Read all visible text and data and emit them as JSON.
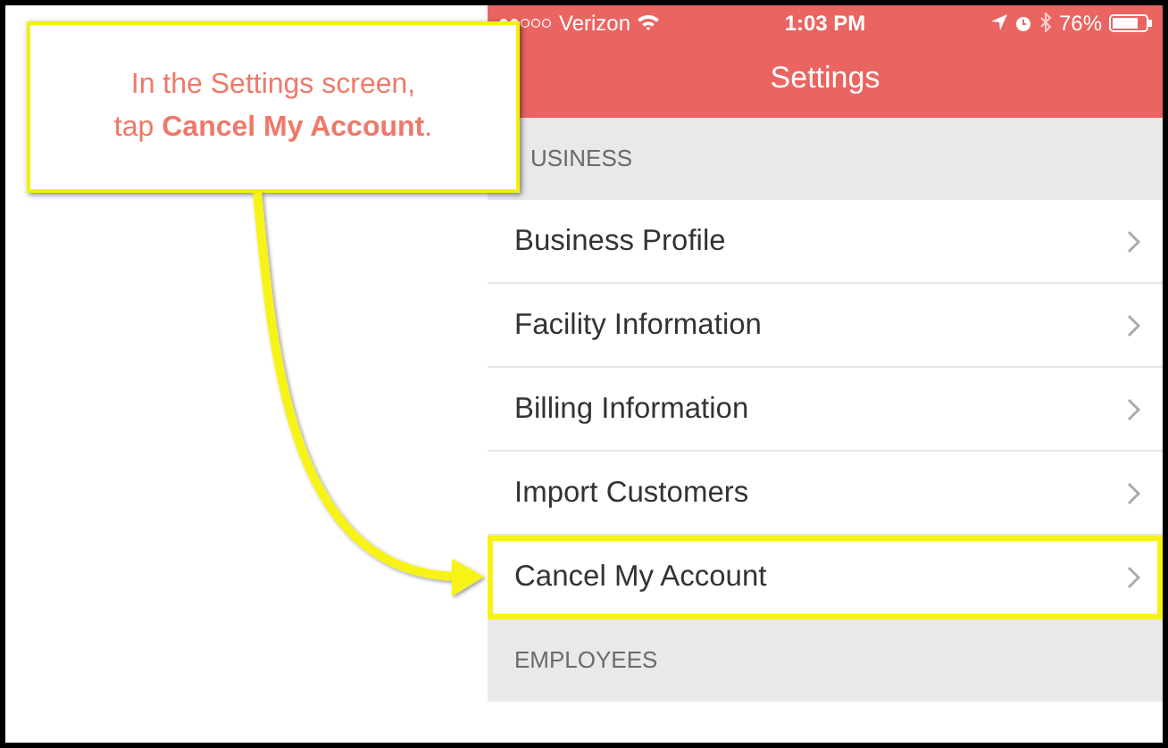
{
  "status_bar": {
    "carrier": "Verizon",
    "time": "1:03 PM",
    "battery": "76%"
  },
  "nav_bar": {
    "title": "Settings"
  },
  "sections": [
    {
      "header": "USINESS",
      "rows": [
        {
          "label": "Business Profile",
          "highlighted": false
        },
        {
          "label": "Facility Information",
          "highlighted": false
        },
        {
          "label": "Billing Information",
          "highlighted": false
        },
        {
          "label": "Import Customers",
          "highlighted": false
        },
        {
          "label": "Cancel My Account",
          "highlighted": true
        }
      ]
    },
    {
      "header": "EMPLOYEES"
    }
  ],
  "callout": {
    "text": "In the Settings screen,\ntap **Cancel My Account**."
  }
}
